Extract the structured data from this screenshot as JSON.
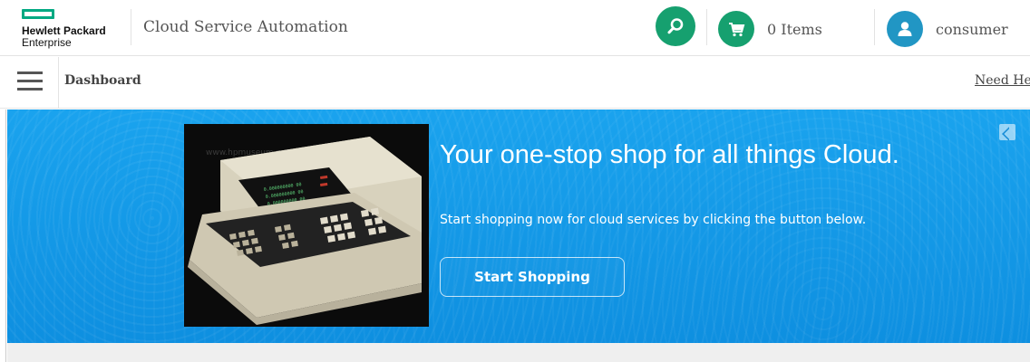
{
  "brand": {
    "line1": "Hewlett Packard",
    "line2": "Enterprise",
    "color": "#01a982"
  },
  "header": {
    "app_title": "Cloud Service Automation",
    "search_icon": "search-icon",
    "cart": {
      "icon": "cart-icon",
      "label": "0 Items"
    },
    "user": {
      "icon": "user-icon",
      "label": "consumer"
    }
  },
  "subbar": {
    "menu_icon": "hamburger-icon",
    "breadcrumb": "Dashboard",
    "help_link": "Need Hel"
  },
  "hero": {
    "title": "Your one-stop shop for all things Cloud.",
    "subtitle": "Start shopping now for cloud services by clicking the button below.",
    "button_label": "Start Shopping",
    "photo_watermark": "www.hpmuseum.net",
    "background_color": "#1aa3ee",
    "expand_icon": "expand-icon"
  },
  "colors": {
    "accent_green": "#16a06f",
    "accent_blue": "#2196c4"
  }
}
